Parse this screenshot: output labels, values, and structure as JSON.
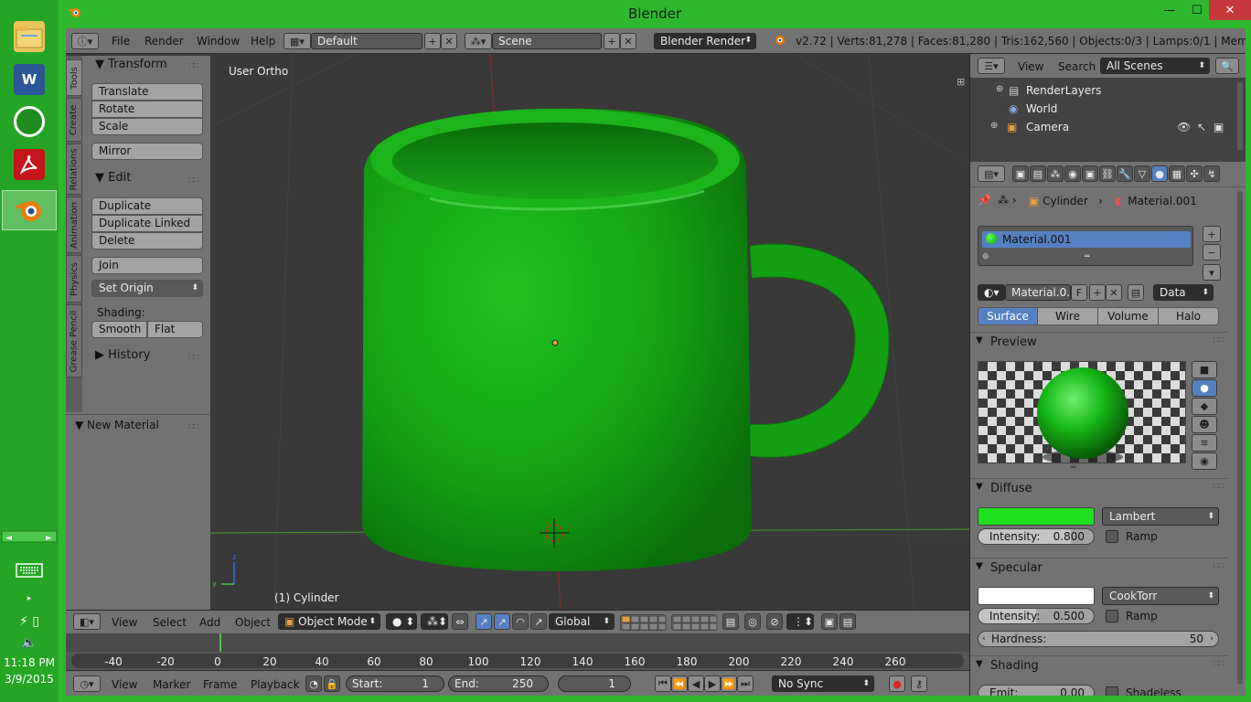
{
  "taskbar": {
    "clock": "11:18 PM",
    "date": "3/9/2015",
    "apps": [
      {
        "name": "File Explorer"
      },
      {
        "name": "Word",
        "letter": "W"
      },
      {
        "name": "Xbox"
      },
      {
        "name": "Adobe Reader"
      },
      {
        "name": "Blender"
      }
    ]
  },
  "window": {
    "title": "Blender",
    "min_label": "—",
    "max_label": "☐",
    "close_label": "✕"
  },
  "info_header": {
    "menus": [
      "File",
      "Render",
      "Window",
      "Help"
    ],
    "layout": "Default",
    "scene": "Scene",
    "engine": "Blender Render",
    "stats": "v2.72 | Verts:81,278 | Faces:81,280 | Tris:162,560 | Objects:0/3 | Lamps:0/1 | Mem:17.57M (0"
  },
  "tool_tabs": [
    "Tools",
    "Create",
    "Relations",
    "Animation",
    "Physics",
    "Grease Pencil"
  ],
  "tool_shelf": {
    "transform_title": "Transform",
    "translate": "Translate",
    "rotate": "Rotate",
    "scale": "Scale",
    "mirror": "Mirror",
    "edit_title": "Edit",
    "duplicate": "Duplicate",
    "duplicate_linked": "Duplicate Linked",
    "delete": "Delete",
    "join": "Join",
    "set_origin": "Set Origin",
    "shading_label": "Shading:",
    "smooth": "Smooth",
    "flat": "Flat",
    "history_title": "History",
    "new_material_title": "New Material"
  },
  "viewport": {
    "view_name": "User Ortho",
    "object_label": "(1) Cylinder",
    "mug_color": "#12a512"
  },
  "view3d_header": {
    "menus": [
      "View",
      "Select",
      "Add",
      "Object"
    ],
    "mode": "Object Mode",
    "orientation": "Global"
  },
  "timeline": {
    "ticks": [
      "-40",
      "-20",
      "0",
      "20",
      "40",
      "60",
      "80",
      "100",
      "120",
      "140",
      "160",
      "180",
      "200",
      "220",
      "240",
      "260"
    ]
  },
  "timeline_header": {
    "menus": [
      "View",
      "Marker",
      "Frame",
      "Playback"
    ],
    "start": "Start:",
    "start_value": "1",
    "end": "End:",
    "end_value": "250",
    "current": "1",
    "sync": "No Sync"
  },
  "outliner": {
    "view": "View",
    "search": "Search",
    "filter": "All Scenes",
    "rows": [
      "RenderLayers",
      "World",
      "Camera"
    ]
  },
  "properties": {
    "breadcrumb_object": "Cylinder",
    "breadcrumb_material": "Material.001",
    "slot": "Material.001",
    "material_name": "Material.0...",
    "fake_user": "F",
    "link": "Data",
    "tabs": [
      "Surface",
      "Wire",
      "Volume",
      "Halo"
    ],
    "preview_title": "Preview",
    "diffuse_title": "Diffuse",
    "diffuse_color": "#1ee01e",
    "diffuse_shader": "Lambert",
    "diffuse_intensity_label": "Intensity:",
    "diffuse_intensity": "0.800",
    "diffuse_intensity_value": 0.8,
    "ramp": "Ramp",
    "specular_title": "Specular",
    "specular_color": "#ffffff",
    "specular_shader": "CookTorr",
    "specular_intensity_label": "Intensity:",
    "specular_intensity": "0.500",
    "specular_intensity_value": 0.5,
    "hardness_label": "Hardness:",
    "hardness": "50",
    "shading_title": "Shading",
    "emit_label": "Emit:",
    "emit": "0.00",
    "shadeless": "Shadeless"
  }
}
